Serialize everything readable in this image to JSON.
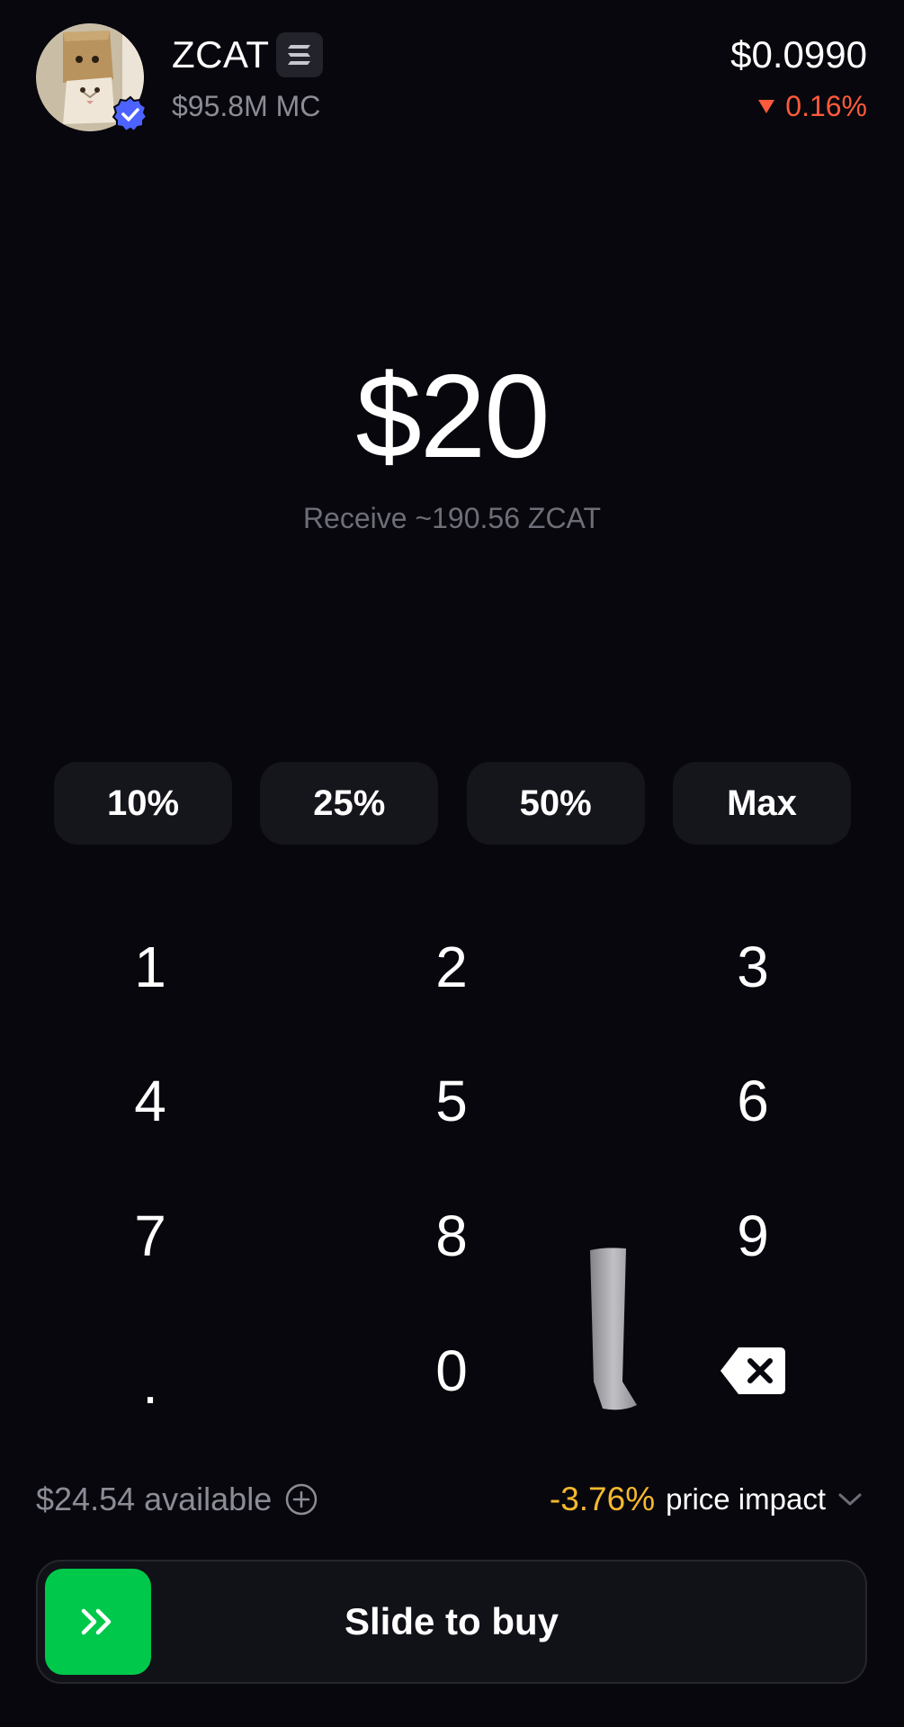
{
  "token": {
    "name": "ZCAT",
    "chain_icon": "solana-icon",
    "market_cap": "$95.8M MC",
    "price": "$0.0990",
    "change": "0.16%",
    "change_direction": "down",
    "change_color": "#ff5a3c",
    "verified_color": "#4d63ff"
  },
  "order": {
    "amount": "$20",
    "receive": "Receive ~190.56 ZCAT"
  },
  "presets": [
    "10%",
    "25%",
    "50%",
    "Max"
  ],
  "keypad": {
    "k1": "1",
    "k2": "2",
    "k3": "3",
    "k4": "4",
    "k5": "5",
    "k6": "6",
    "k7": "7",
    "k8": "8",
    "k9": "9",
    "dot": ".",
    "k0": "0",
    "backspace_icon": "backspace-icon"
  },
  "footer": {
    "available": "$24.54 available",
    "price_impact_value": "-3.76%",
    "price_impact_label": "price impact",
    "impact_color": "#f5b82e"
  },
  "slider": {
    "label": "Slide to buy",
    "handle_color": "#00c84a"
  }
}
